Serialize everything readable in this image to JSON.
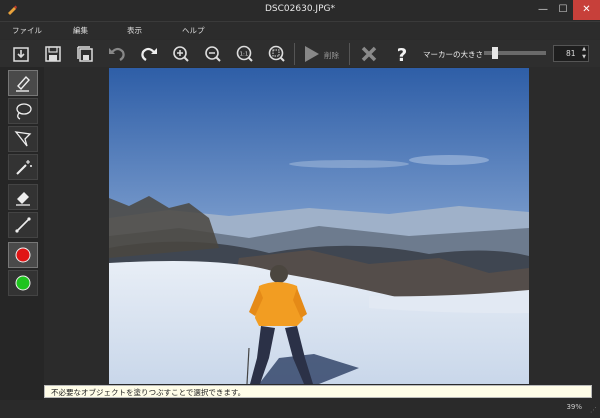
{
  "window": {
    "title": "DSC02630.JPG*",
    "minimize": "—",
    "maximize": "☐",
    "close": "✕"
  },
  "menu": [
    "ファイル",
    "編集",
    "表示",
    "ヘルプ"
  ],
  "toolbar": {
    "delete_label": "削除",
    "marker_label": "マーカーの大きさ",
    "marker_value": "81",
    "marker_slider_fraction": 0.15
  },
  "hint": "不必要なオブジェクトを塗りつぶすことで選択できます。",
  "status": {
    "zoom": "39%"
  },
  "colors": {
    "red": "#e01515",
    "green": "#1fc41f",
    "accent": "#2fa4e7"
  }
}
